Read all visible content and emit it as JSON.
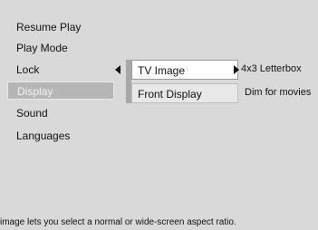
{
  "main_menu": {
    "items": [
      {
        "label": "Resume Play"
      },
      {
        "label": "Play Mode"
      },
      {
        "label": "Lock"
      },
      {
        "label": "Display"
      },
      {
        "label": "Sound"
      },
      {
        "label": "Languages"
      }
    ],
    "selected": "Display"
  },
  "submenu": {
    "items": [
      {
        "label": "TV Image",
        "value": "4x3 Letterbox"
      },
      {
        "label": "Front Display",
        "value": "Dim for movies"
      }
    ],
    "highlighted": "TV Image"
  },
  "help_text": "image lets you select a normal or wide-screen aspect ratio.",
  "colors": {
    "background": "#d9d9d9",
    "selected_main": "#b6b6b6",
    "highlight_sub": "#ffffff",
    "text": "#111111"
  }
}
